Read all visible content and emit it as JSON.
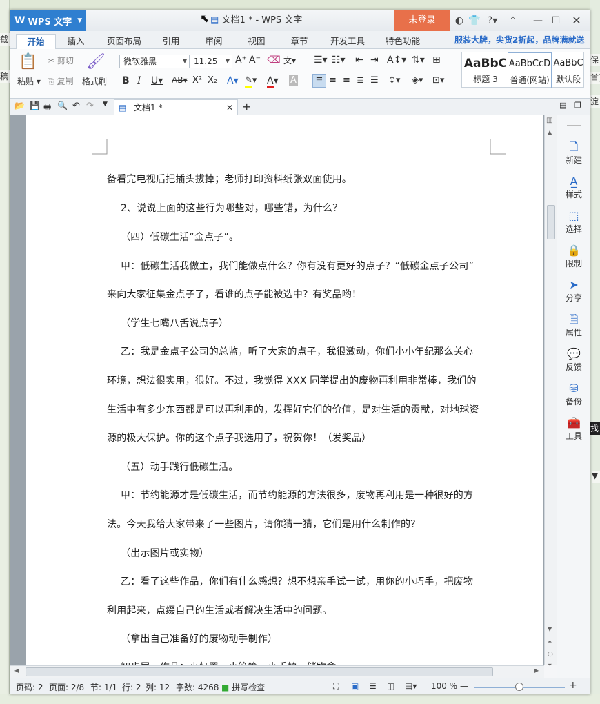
{
  "background": {
    "left_bits": [
      "截",
      "稿"
    ],
    "right_bits": [
      "保",
      "首页",
      "淀",
      "找",
      "▼"
    ]
  },
  "titlebar": {
    "app_button": "WPS 文字",
    "window_title": "文档1 * - WPS 文字",
    "login_label": "未登录"
  },
  "tabs": [
    "开始",
    "插入",
    "页面布局",
    "引用",
    "审阅",
    "视图",
    "章节",
    "开发工具",
    "特色功能"
  ],
  "promo": "服装大牌，尖货2折起，品牌满就送",
  "ribbon": {
    "paste": "粘贴",
    "cut": "剪切",
    "copy": "复制",
    "format_painter": "格式刷",
    "font_name": "微软雅黑",
    "font_size": "11.25",
    "styles": [
      {
        "sample": "AaBbC",
        "name": "标题 3"
      },
      {
        "sample": "AaBbCcD",
        "name": "普通(网站)"
      },
      {
        "sample": "AaBbC",
        "name": "默认段"
      }
    ]
  },
  "document_tab": {
    "name": "文档1 *"
  },
  "document": {
    "paragraphs": [
      "备看完电视后把插头拔掉；老师打印资料纸张双面使用。",
      "2、说说上面的这些行为哪些对，哪些错，为什么？",
      "（四）低碳生活“金点子”。",
      "甲：低碳生活我做主，我们能做点什么？你有没有更好的点子？“低碳金点子公司”",
      "来向大家征集金点子了，看谁的点子能被选中？有奖品哟！",
      "（学生七嘴八舌说点子）",
      "乙：我是金点子公司的总监，听了大家的点子，我很激动，你们小小年纪那么关心",
      "环境，想法很实用，很好。不过，我觉得 XXX 同学提出的废物再利用非常棒，我们的",
      "生活中有多少东西都是可以再利用的，发挥好它们的价值，是对生活的贡献，对地球资",
      "源的极大保护。你的这个点子我选用了，祝贺你！（发奖品）",
      "（五）动手践行低碳生活。",
      "甲：节约能源才是低碳生活，而节约能源的方法很多，废物再利用是一种很好的方",
      "法。今天我给大家带来了一些图片，请你猜一猜，它们是用什么制作的？",
      "（出示图片或实物）",
      "乙：看了这些作品，你们有什么感想？想不想亲手试一试，用你的小巧手，把废物",
      "利用起来，点缀自己的生活或者解决生活中的问题。",
      "（拿出自己准备好的废物动手制作）",
      "初步展示作品：小灯罩、小笔筒、小手帕、储物盒……"
    ]
  },
  "side_panel": [
    "新建",
    "样式",
    "选择",
    "限制",
    "分享",
    "属性",
    "反馈",
    "备份",
    "工具"
  ],
  "statusbar": {
    "page_code": "页码: 2",
    "pages": "页面: 2/8",
    "section": "节: 1/1",
    "row": "行: 2",
    "col": "列: 12",
    "word_count": "字数: 4268",
    "spell_check": "拼写检查",
    "zoom": "100 %"
  },
  "colors": {
    "accent": "#2f7fd0",
    "login": "#e8704a",
    "promo": "#2a6bc8"
  }
}
